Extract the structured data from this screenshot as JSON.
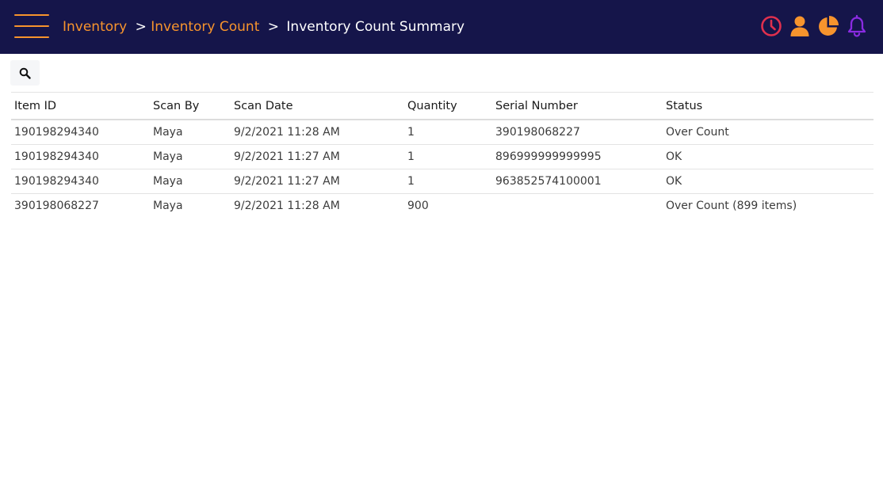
{
  "breadcrumb": {
    "items": [
      "Inventory",
      "Inventory Count"
    ],
    "separator": ">",
    "current": "Inventory Count Summary"
  },
  "header_icons": [
    {
      "name": "clock-icon",
      "color": "#e0304e"
    },
    {
      "name": "user-icon",
      "color": "#f7942d"
    },
    {
      "name": "pie-chart-icon",
      "color": "#f7942d"
    },
    {
      "name": "bell-icon",
      "color": "#8a2be2"
    }
  ],
  "colors": {
    "header_bg": "#15154a",
    "accent_orange": "#f7942d",
    "accent_red": "#e0304e",
    "accent_purple": "#8a2be2"
  },
  "search": {
    "icon": "search-icon"
  },
  "table": {
    "headers": [
      "Item ID",
      "Scan By",
      "Scan Date",
      "Quantity",
      "Serial Number",
      "Status"
    ],
    "rows": [
      [
        "190198294340",
        "Maya",
        "9/2/2021 11:28 AM",
        "1",
        "390198068227",
        "Over Count"
      ],
      [
        "190198294340",
        "Maya",
        "9/2/2021 11:27 AM",
        "1",
        "896999999999995",
        "OK"
      ],
      [
        "190198294340",
        "Maya",
        "9/2/2021 11:27 AM",
        "1",
        "963852574100001",
        "OK"
      ],
      [
        "390198068227",
        "Maya",
        "9/2/2021 11:28 AM",
        "900",
        "",
        "Over Count (899 items)"
      ]
    ]
  }
}
